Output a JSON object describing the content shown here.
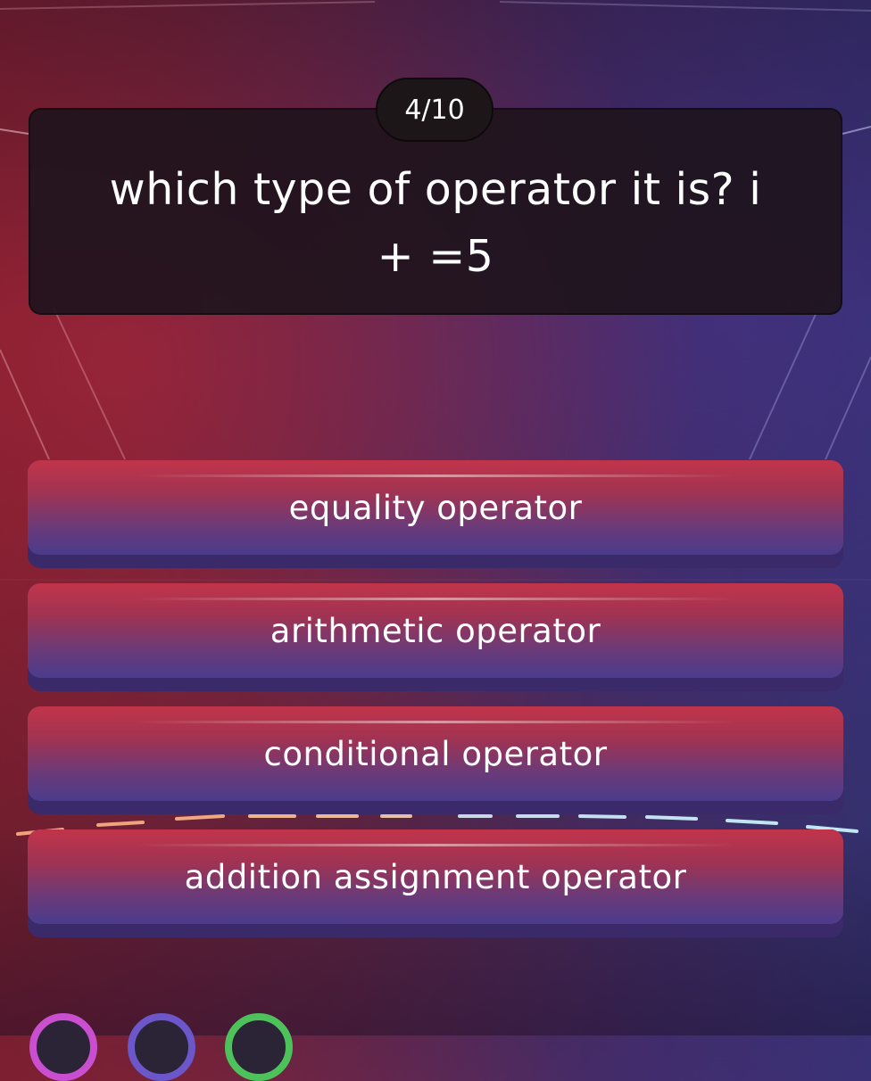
{
  "quiz": {
    "progress_label": "4/10",
    "current_question": 4,
    "total_questions": 10,
    "question": "which type of operator it is? i\n+ =5",
    "options": [
      {
        "label": "equality operator"
      },
      {
        "label": "arithmetic operator"
      },
      {
        "label": "conditional operator"
      },
      {
        "label": "addition assignment operator"
      }
    ]
  },
  "powerups": [
    {
      "icon": "powerup-icon",
      "ring_color": "#c94fd0"
    },
    {
      "icon": "powerup-icon",
      "ring_color": "#6b57c9"
    },
    {
      "icon": "powerup-icon",
      "ring_color": "#4ec25a"
    }
  ],
  "colors": {
    "option_top": "#c1344a",
    "option_bottom": "#4a3c8c",
    "card_background": "#1e141c"
  }
}
